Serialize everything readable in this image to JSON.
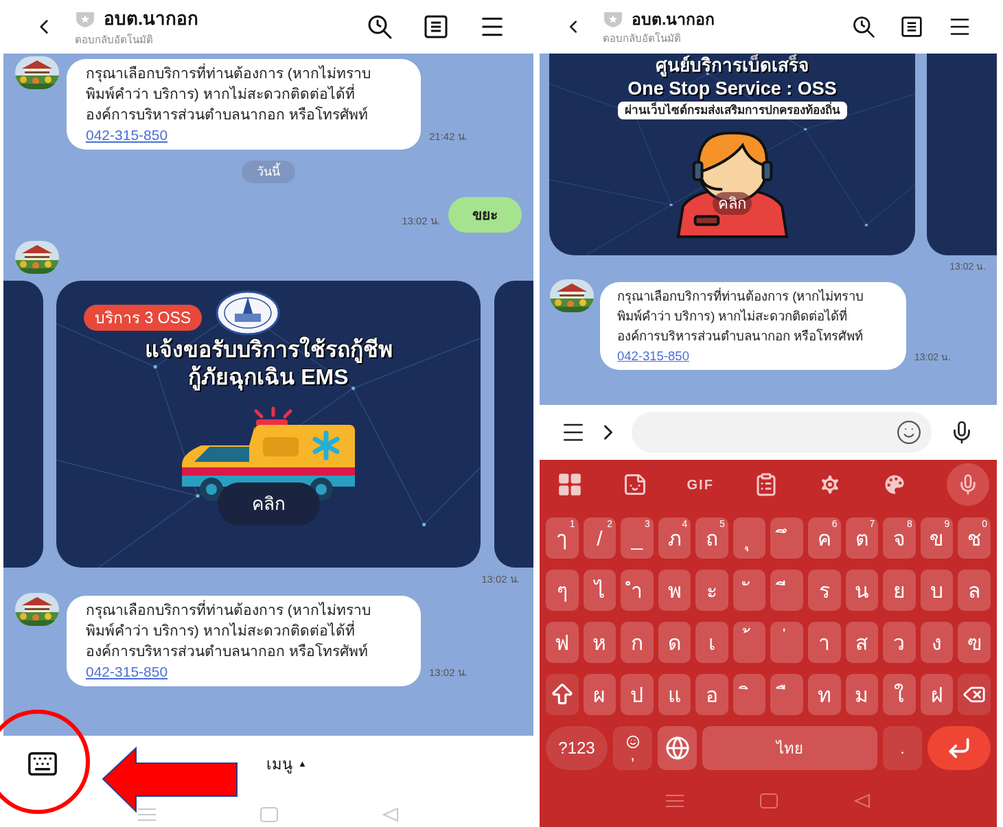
{
  "screens": [
    {
      "header": {
        "title": "อบต.นากอก",
        "subtitle": "ตอบกลับอัตโนมัติ"
      },
      "messages": [
        {
          "kind": "incoming_text",
          "text": "กรุณาเลือกบริการที่ท่านต้องการ (หากไม่ทราบ พิมพ์คำว่า บริการ) หากไม่สะดวกติดต่อได้ที่องค์การบริหารส่วนตำบลนากอก หรือโทรศัพท์",
          "link": "042-315-850",
          "time": "21:42 น."
        },
        {
          "kind": "date",
          "text": "วันนี้"
        },
        {
          "kind": "outgoing_text",
          "text": "ขยะ",
          "time": "13:02 น."
        },
        {
          "kind": "avatar"
        },
        {
          "kind": "carousel",
          "time": "13:02 น.",
          "card": {
            "kind": "ambulance",
            "badge": "บริการ 3 OSS",
            "title_lines": [
              "แจ้งขอรับบริการใช้รถกู้ชีพ",
              "กู้ภัยฉุกเฉิน EMS"
            ],
            "button": "คลิก"
          }
        },
        {
          "kind": "incoming_text",
          "text": "กรุณาเลือกบริการที่ท่านต้องการ (หากไม่ทราบ พิมพ์คำว่า บริการ) หากไม่สะดวกติดต่อได้ที่องค์การบริหารส่วนตำบลนากอก หรือโทรศัพท์",
          "link": "042-315-850",
          "time": "13:02 น."
        }
      ],
      "bottom": {
        "kind": "menu_bar",
        "menu_label": "เมนู",
        "menu_arrow": "▲"
      }
    },
    {
      "header": {
        "title": "อบต.นากอก",
        "subtitle": "ตอบกลับอัตโนมัติ"
      },
      "messages": [
        {
          "kind": "carousel",
          "time": "13:02 น.",
          "card": {
            "kind": "agent",
            "title_lines": [
              "ศูนย์บริการเบ็ดเสร็จ",
              "One Stop Service : OSS"
            ],
            "subtitle": "ผ่านเว็บไซต์กรมส่งเสริมการปกครองท้องถิ่น",
            "button": "คลิก"
          }
        },
        {
          "kind": "incoming_text",
          "text": "กรุณาเลือกบริการที่ท่านต้องการ (หากไม่ทราบ พิมพ์คำว่า บริการ) หากไม่สะดวกติดต่อได้ที่องค์การบริหารส่วนตำบลนากอก หรือโทรศัพท์",
          "link": "042-315-850",
          "time": "13:02 น."
        }
      ],
      "bottom": {
        "kind": "keyboard",
        "toolbar": [
          {
            "kind": "grid"
          },
          {
            "kind": "sticker"
          },
          {
            "kind": "gif",
            "label": "GIF"
          },
          {
            "kind": "clipboard"
          },
          {
            "kind": "settings"
          },
          {
            "kind": "palette"
          },
          {
            "kind": "mic"
          }
        ],
        "rows": [
          [
            {
              "kind": "char",
              "label": "ๅ",
              "hint": "1"
            },
            {
              "kind": "char",
              "label": "/",
              "hint": "2"
            },
            {
              "kind": "char",
              "label": "_",
              "hint": "3"
            },
            {
              "kind": "char",
              "label": "ภ",
              "hint": "4"
            },
            {
              "kind": "char",
              "label": "ถ",
              "hint": "5"
            },
            {
              "kind": "char",
              "label": "ุ"
            },
            {
              "kind": "char",
              "label": "ึ"
            },
            {
              "kind": "char",
              "label": "ค",
              "hint": "6"
            },
            {
              "kind": "char",
              "label": "ต",
              "hint": "7"
            },
            {
              "kind": "char",
              "label": "จ",
              "hint": "8"
            },
            {
              "kind": "char",
              "label": "ข",
              "hint": "9"
            },
            {
              "kind": "char",
              "label": "ช",
              "hint": "0"
            }
          ],
          [
            {
              "kind": "char",
              "label": "ๆ"
            },
            {
              "kind": "char",
              "label": "ไ"
            },
            {
              "kind": "char",
              "label": "ำ"
            },
            {
              "kind": "char",
              "label": "พ"
            },
            {
              "kind": "char",
              "label": "ะ"
            },
            {
              "kind": "char",
              "label": "ั"
            },
            {
              "kind": "char",
              "label": "ี"
            },
            {
              "kind": "char",
              "label": "ร"
            },
            {
              "kind": "char",
              "label": "น"
            },
            {
              "kind": "char",
              "label": "ย"
            },
            {
              "kind": "char",
              "label": "บ"
            },
            {
              "kind": "char",
              "label": "ล"
            }
          ],
          [
            {
              "kind": "char",
              "label": "ฟ"
            },
            {
              "kind": "char",
              "label": "ห"
            },
            {
              "kind": "char",
              "label": "ก"
            },
            {
              "kind": "char",
              "label": "ด"
            },
            {
              "kind": "char",
              "label": "เ"
            },
            {
              "kind": "char",
              "label": "้"
            },
            {
              "kind": "char",
              "label": "่"
            },
            {
              "kind": "char",
              "label": "า"
            },
            {
              "kind": "char",
              "label": "ส"
            },
            {
              "kind": "char",
              "label": "ว"
            },
            {
              "kind": "char",
              "label": "ง"
            },
            {
              "kind": "char",
              "label": "ฃ"
            }
          ],
          [
            {
              "kind": "shift"
            },
            {
              "kind": "char",
              "label": "ผ"
            },
            {
              "kind": "char",
              "label": "ป"
            },
            {
              "kind": "char",
              "label": "แ"
            },
            {
              "kind": "char",
              "label": "อ"
            },
            {
              "kind": "char",
              "label": "ิ"
            },
            {
              "kind": "char",
              "label": "ื"
            },
            {
              "kind": "char",
              "label": "ท"
            },
            {
              "kind": "char",
              "label": "ม"
            },
            {
              "kind": "char",
              "label": "ใ"
            },
            {
              "kind": "char",
              "label": "ฝ"
            },
            {
              "kind": "backspace"
            }
          ]
        ],
        "bottom_row": [
          {
            "kind": "symbols",
            "label": "?123"
          },
          {
            "kind": "emoji",
            "label": ","
          },
          {
            "kind": "globe"
          },
          {
            "kind": "space",
            "label": "ไทย"
          },
          {
            "kind": "period",
            "label": "."
          },
          {
            "kind": "enter"
          }
        ]
      }
    }
  ],
  "annotations": [
    {
      "kind": "circle"
    },
    {
      "kind": "arrow"
    }
  ]
}
